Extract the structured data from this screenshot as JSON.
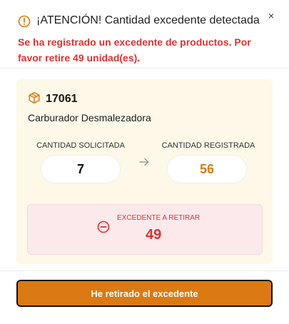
{
  "dialog": {
    "title": "¡ATENCIÓN! Cantidad excedente detectada",
    "message": "Se ha registrado un excedente de productos. Por favor retire 49 unidad(es).",
    "close_label": "×"
  },
  "product": {
    "code": "17061",
    "name": "Carburador Desmalezadora"
  },
  "quantities": {
    "requested_label": "CANTIDAD SOLICITADA",
    "requested_value": "7",
    "registered_label": "CANTIDAD REGISTRADA",
    "registered_value": "56"
  },
  "excess": {
    "label": "EXCEDENTE A RETIRAR",
    "value": "49"
  },
  "actions": {
    "confirm_label": "He retirado el excedente"
  },
  "colors": {
    "warning": "#db7a13",
    "danger": "#e03131",
    "card_bg": "#fdf8e8",
    "excess_bg": "#fce9ec",
    "registered_value": "#db7a13"
  },
  "icons": {
    "warning": "warning-circle-icon",
    "close": "close-icon",
    "product": "package-icon",
    "arrow": "arrow-right-icon",
    "excess": "minus-circle-icon"
  }
}
